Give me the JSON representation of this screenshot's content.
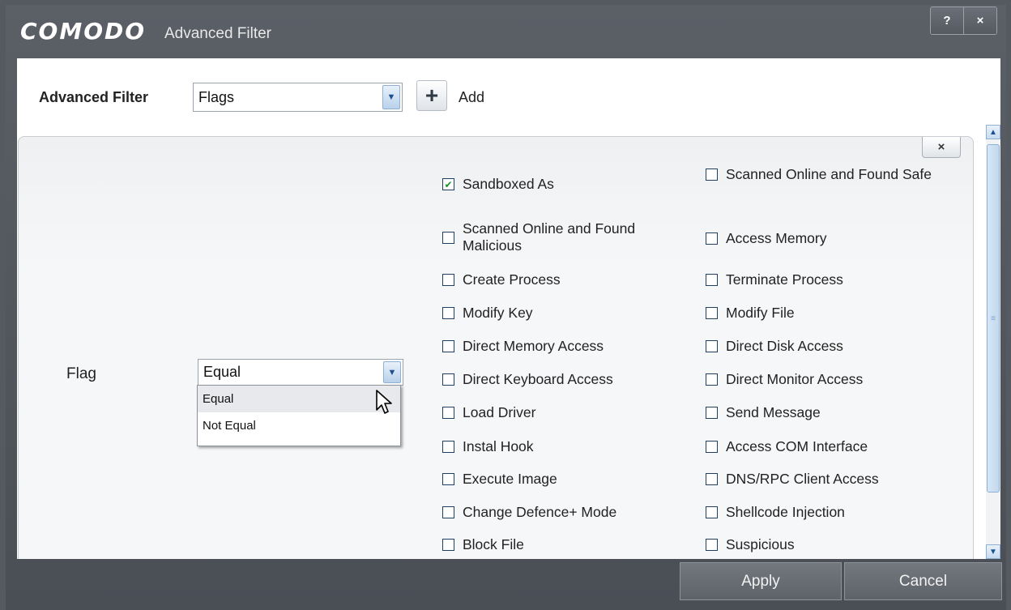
{
  "title_bar": {
    "brand": "COMODO",
    "title": "Advanced Filter",
    "help_label": "?",
    "close_label": "×"
  },
  "filter_row": {
    "label": "Advanced Filter",
    "selected": "Flags",
    "add_label": "Add"
  },
  "panel": {
    "close_label": "×",
    "flag_label": "Flag",
    "operator": {
      "selected": "Equal",
      "options": [
        "Equal",
        "Not Equal"
      ],
      "hovered": "Equal"
    },
    "checkboxes": [
      {
        "label": "Sandboxed As",
        "checked": true
      },
      {
        "label": "Scanned Online and Found Safe",
        "checked": false
      },
      {
        "label": "Scanned Online and Found Malicious",
        "checked": false
      },
      {
        "label": "Access Memory",
        "checked": false
      },
      {
        "label": "Create Process",
        "checked": false
      },
      {
        "label": "Terminate Process",
        "checked": false
      },
      {
        "label": "Modify Key",
        "checked": false
      },
      {
        "label": "Modify File",
        "checked": false
      },
      {
        "label": "Direct Memory Access",
        "checked": false
      },
      {
        "label": "Direct Disk Access",
        "checked": false
      },
      {
        "label": "Direct Keyboard Access",
        "checked": false
      },
      {
        "label": "Direct Monitor Access",
        "checked": false
      },
      {
        "label": "Load Driver",
        "checked": false
      },
      {
        "label": "Send Message",
        "checked": false
      },
      {
        "label": "Instal Hook",
        "checked": false
      },
      {
        "label": "Access COM Interface",
        "checked": false
      },
      {
        "label": "Execute Image",
        "checked": false
      },
      {
        "label": "DNS/RPC Client Access",
        "checked": false
      },
      {
        "label": "Change Defence+ Mode",
        "checked": false
      },
      {
        "label": "Shellcode Injection",
        "checked": false
      },
      {
        "label": "Block File",
        "checked": false
      },
      {
        "label": "Suspicious",
        "checked": false
      }
    ]
  },
  "footer": {
    "apply_label": "Apply",
    "cancel_label": "Cancel"
  },
  "colors": {
    "chrome": "#4e5259",
    "content_bg": "#ffffff",
    "check_mark": "#1a8f2c",
    "accent": "#8fb0d6"
  },
  "icons": {
    "dropdown": "chevron-down-icon",
    "add": "plus-icon",
    "checkbox_checked": "check-icon",
    "scroll_up": "arrow-up-icon",
    "scroll_down": "arrow-down-icon",
    "pointer": "mouse-cursor-icon"
  }
}
